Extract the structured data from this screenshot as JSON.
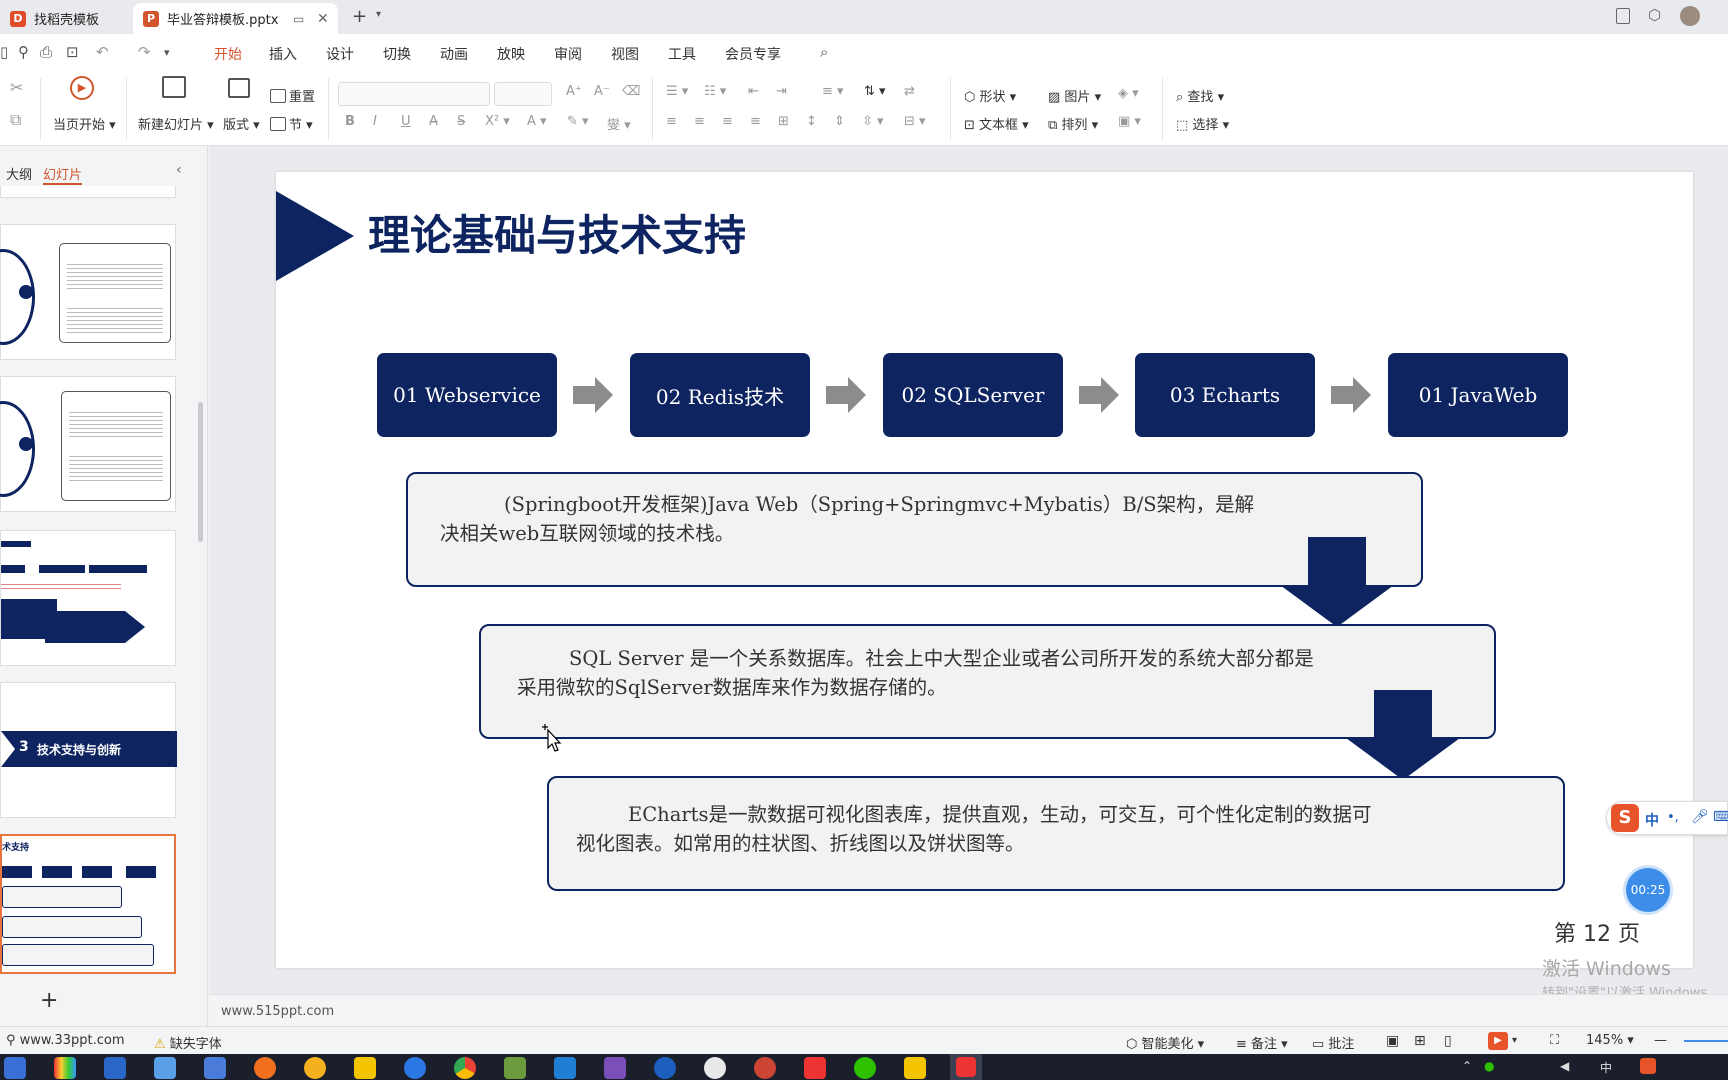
{
  "tabs": [
    {
      "label": "找稻壳模板",
      "logo": "D",
      "color": "#e04b2a"
    },
    {
      "label": "毕业答辩模板.pptx",
      "logo": "P",
      "color": "#d2552c"
    }
  ],
  "menu": [
    "开始",
    "插入",
    "设计",
    "切换",
    "动画",
    "放映",
    "审阅",
    "视图",
    "工具",
    "会员专享"
  ],
  "ribbon": {
    "from_current": "当页开始",
    "new_slide": "新建幻灯片",
    "layout": "版式",
    "reset": "重置",
    "section": "节",
    "shape": "形状",
    "picture": "图片",
    "find": "查找",
    "textbox": "文本框",
    "arrange": "排列",
    "select": "选择"
  },
  "panel": {
    "outline": "大纲",
    "slides": "幻灯片",
    "add": "+"
  },
  "thumbnails": {
    "t3_title": "技术支持与创新",
    "t3_num": "3",
    "t4_title": "术支持"
  },
  "slide": {
    "title": "理论基础与技术支持",
    "flow": [
      "01 Webservice",
      "02 Redis技术",
      "02 SQLServer",
      "03 Echarts",
      "01 JavaWeb"
    ],
    "desc1_l1": "(Springboot开发框架)Java Web（Spring+Springmvc+Mybatis）B/S架构，是解",
    "desc1_l2": "决相关web互联网领域的技术栈。",
    "desc2_l1": "SQL Server 是一个关系数据库。社会上中大型企业或者公司所开发的系统大部分都是",
    "desc2_l2": "采用微软的SqlServer数据库来作为数据存储的。",
    "desc3_l1": "ECharts是一款数据可视化图表库，提供直观，生动，可交互，可个性化定制的数据可",
    "desc3_l2": "视化图表。如常用的柱状图、折线图以及饼状图等。"
  },
  "overlays": {
    "page_label": "第 12 页",
    "activate_l1": "激活 Windows",
    "activate_l2": "转到\"设置\"以激活 Windows",
    "timer": "00:25",
    "ime": "中"
  },
  "notes_url": "www.515ppt.com",
  "status": {
    "site": "www.33ppt.com",
    "missing_font": "缺失字体",
    "beautify": "智能美化",
    "notes": "备注",
    "comments": "批注",
    "zoom": "145%"
  },
  "colors": {
    "navy": "#0d2461",
    "accent": "#d2552c"
  }
}
